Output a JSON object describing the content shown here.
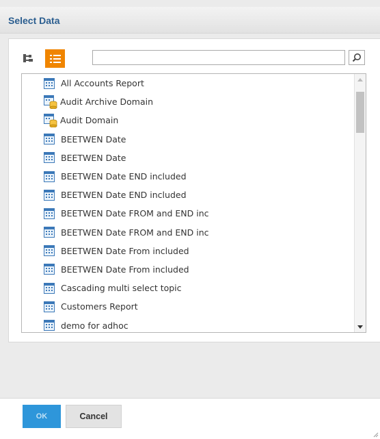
{
  "dialog": {
    "title": "Select Data",
    "search": {
      "value": "",
      "placeholder": ""
    },
    "view_buttons": {
      "tree_icon": "tree-view-icon",
      "list_icon": "list-view-icon",
      "active": "list"
    },
    "items": [
      {
        "label": "All Accounts Report",
        "icon": "report-icon"
      },
      {
        "label": "Audit Archive Domain",
        "icon": "domain-icon"
      },
      {
        "label": "Audit Domain",
        "icon": "domain-icon"
      },
      {
        "label": "BEETWEN Date",
        "icon": "report-icon"
      },
      {
        "label": "BEETWEN Date",
        "icon": "report-icon"
      },
      {
        "label": "BEETWEN Date END included",
        "icon": "report-icon"
      },
      {
        "label": "BEETWEN Date END included",
        "icon": "report-icon"
      },
      {
        "label": "BEETWEN Date FROM and END inc",
        "icon": "report-icon"
      },
      {
        "label": "BEETWEN Date FROM and END inc",
        "icon": "report-icon"
      },
      {
        "label": "BEETWEN Date From included",
        "icon": "report-icon"
      },
      {
        "label": "BEETWEN Date From included",
        "icon": "report-icon"
      },
      {
        "label": "Cascading multi select topic",
        "icon": "report-icon"
      },
      {
        "label": "Customers Report",
        "icon": "report-icon"
      },
      {
        "label": "demo for adhoc",
        "icon": "report-icon"
      }
    ],
    "buttons": {
      "ok": "OK",
      "cancel": "Cancel"
    },
    "colors": {
      "accent_orange": "#f08500",
      "ok_blue": "#2e96da",
      "title_blue": "#2a5d8f"
    }
  }
}
